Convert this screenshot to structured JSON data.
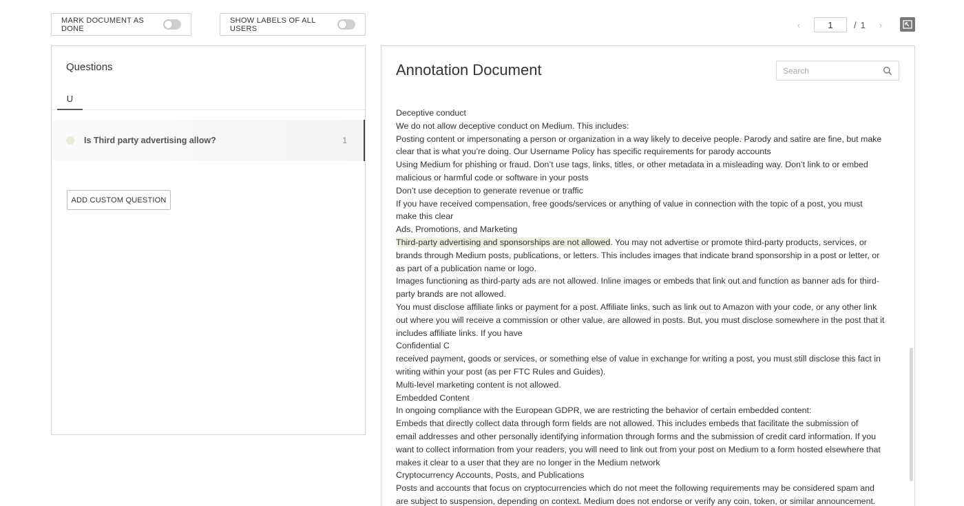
{
  "toolbar": {
    "mark_done_label": "MARK DOCUMENT AS DONE",
    "show_labels_label": "SHOW LABELS OF ALL USERS"
  },
  "pager": {
    "prev_symbol": "‹",
    "next_symbol": "›",
    "current_page": "1",
    "separator": "/",
    "total_pages": "1"
  },
  "questions": {
    "title": "Questions",
    "tab_label": "U",
    "items": [
      {
        "text": "Is Third party advertising allow?",
        "count": "1"
      }
    ],
    "add_custom_label": "ADD CUSTOM QUESTION"
  },
  "document": {
    "title": "Annotation Document",
    "search_placeholder": "Search",
    "lines": [
      "Deceptive conduct",
      "We do not allow deceptive conduct on Medium. This includes:",
      "Posting content or impersonating a person or organization in a way likely to deceive people. Parody and satire are fine, but make",
      "clear that is what you’re doing. Our Username Policy has specific requirements for parody accounts",
      "Using Medium for phishing or fraud. Don’t use tags, links, titles, or other metadata in a misleading way. Don’t link to or embed",
      "malicious or harmful code or software in your posts",
      "Don’t use deception to generate revenue or traffic",
      "If you have received compensation, free goods/services or anything of value in connection with the topic of a post, you must",
      "make this clear",
      "Ads, Promotions, and Marketing",
      "__HL__",
      "brands through Medium posts, publications, or letters. This includes images that indicate brand sponsorship in a post or letter, or",
      "as part of a publication name or logo.",
      "Images functioning as third-party ads are not allowed. Inline images or embeds that link out and function as banner ads for third-",
      "party brands are not allowed.",
      "You must disclose affiliate links or payment for a post. Affiliate links, such as link out to Amazon with your code, or any other link",
      "out where you will receive a commission or other value, are allowed in posts. But, you must disclose somewhere in the post that it",
      "includes affiliate links. If you have",
      "Confidential C",
      "received payment, goods or services, or something else of value in exchange for writing a post, you must still disclose this fact in",
      "writing within your post (as per FTC Rules and Guides).",
      "Multi-level marketing content is not allowed.",
      "Embedded Content",
      "In ongoing compliance with the European GDPR, we are restricting the behavior of certain embedded content:",
      "Embeds that directly collect data through form fields are not allowed. This includes embeds that facilitate the submission of",
      "email addresses and other personally identifying information through forms and the submission of credit card information. If you",
      "want to collect information from your readers, you will need to link out from your post on Medium to a form hosted elsewhere that",
      "makes it clear to a user that they are no longer in the Medium network",
      "Cryptocurrency Accounts, Posts, and Publications",
      "Posts and accounts that focus on cryptocurrencies which do not meet the following requirements may be considered spam and",
      "are subject to suspension, depending on context. Medium does not endorse or verify any coin, token, or similar announcement."
    ],
    "highlight": {
      "marked": "Third-party advertising and sponsorships are not allowed",
      "rest": ". You may not advertise or promote third-party products, services, or"
    }
  },
  "colors": {
    "highlight": "#eef0df",
    "border": "#d6d6d6",
    "text": "#333333"
  }
}
